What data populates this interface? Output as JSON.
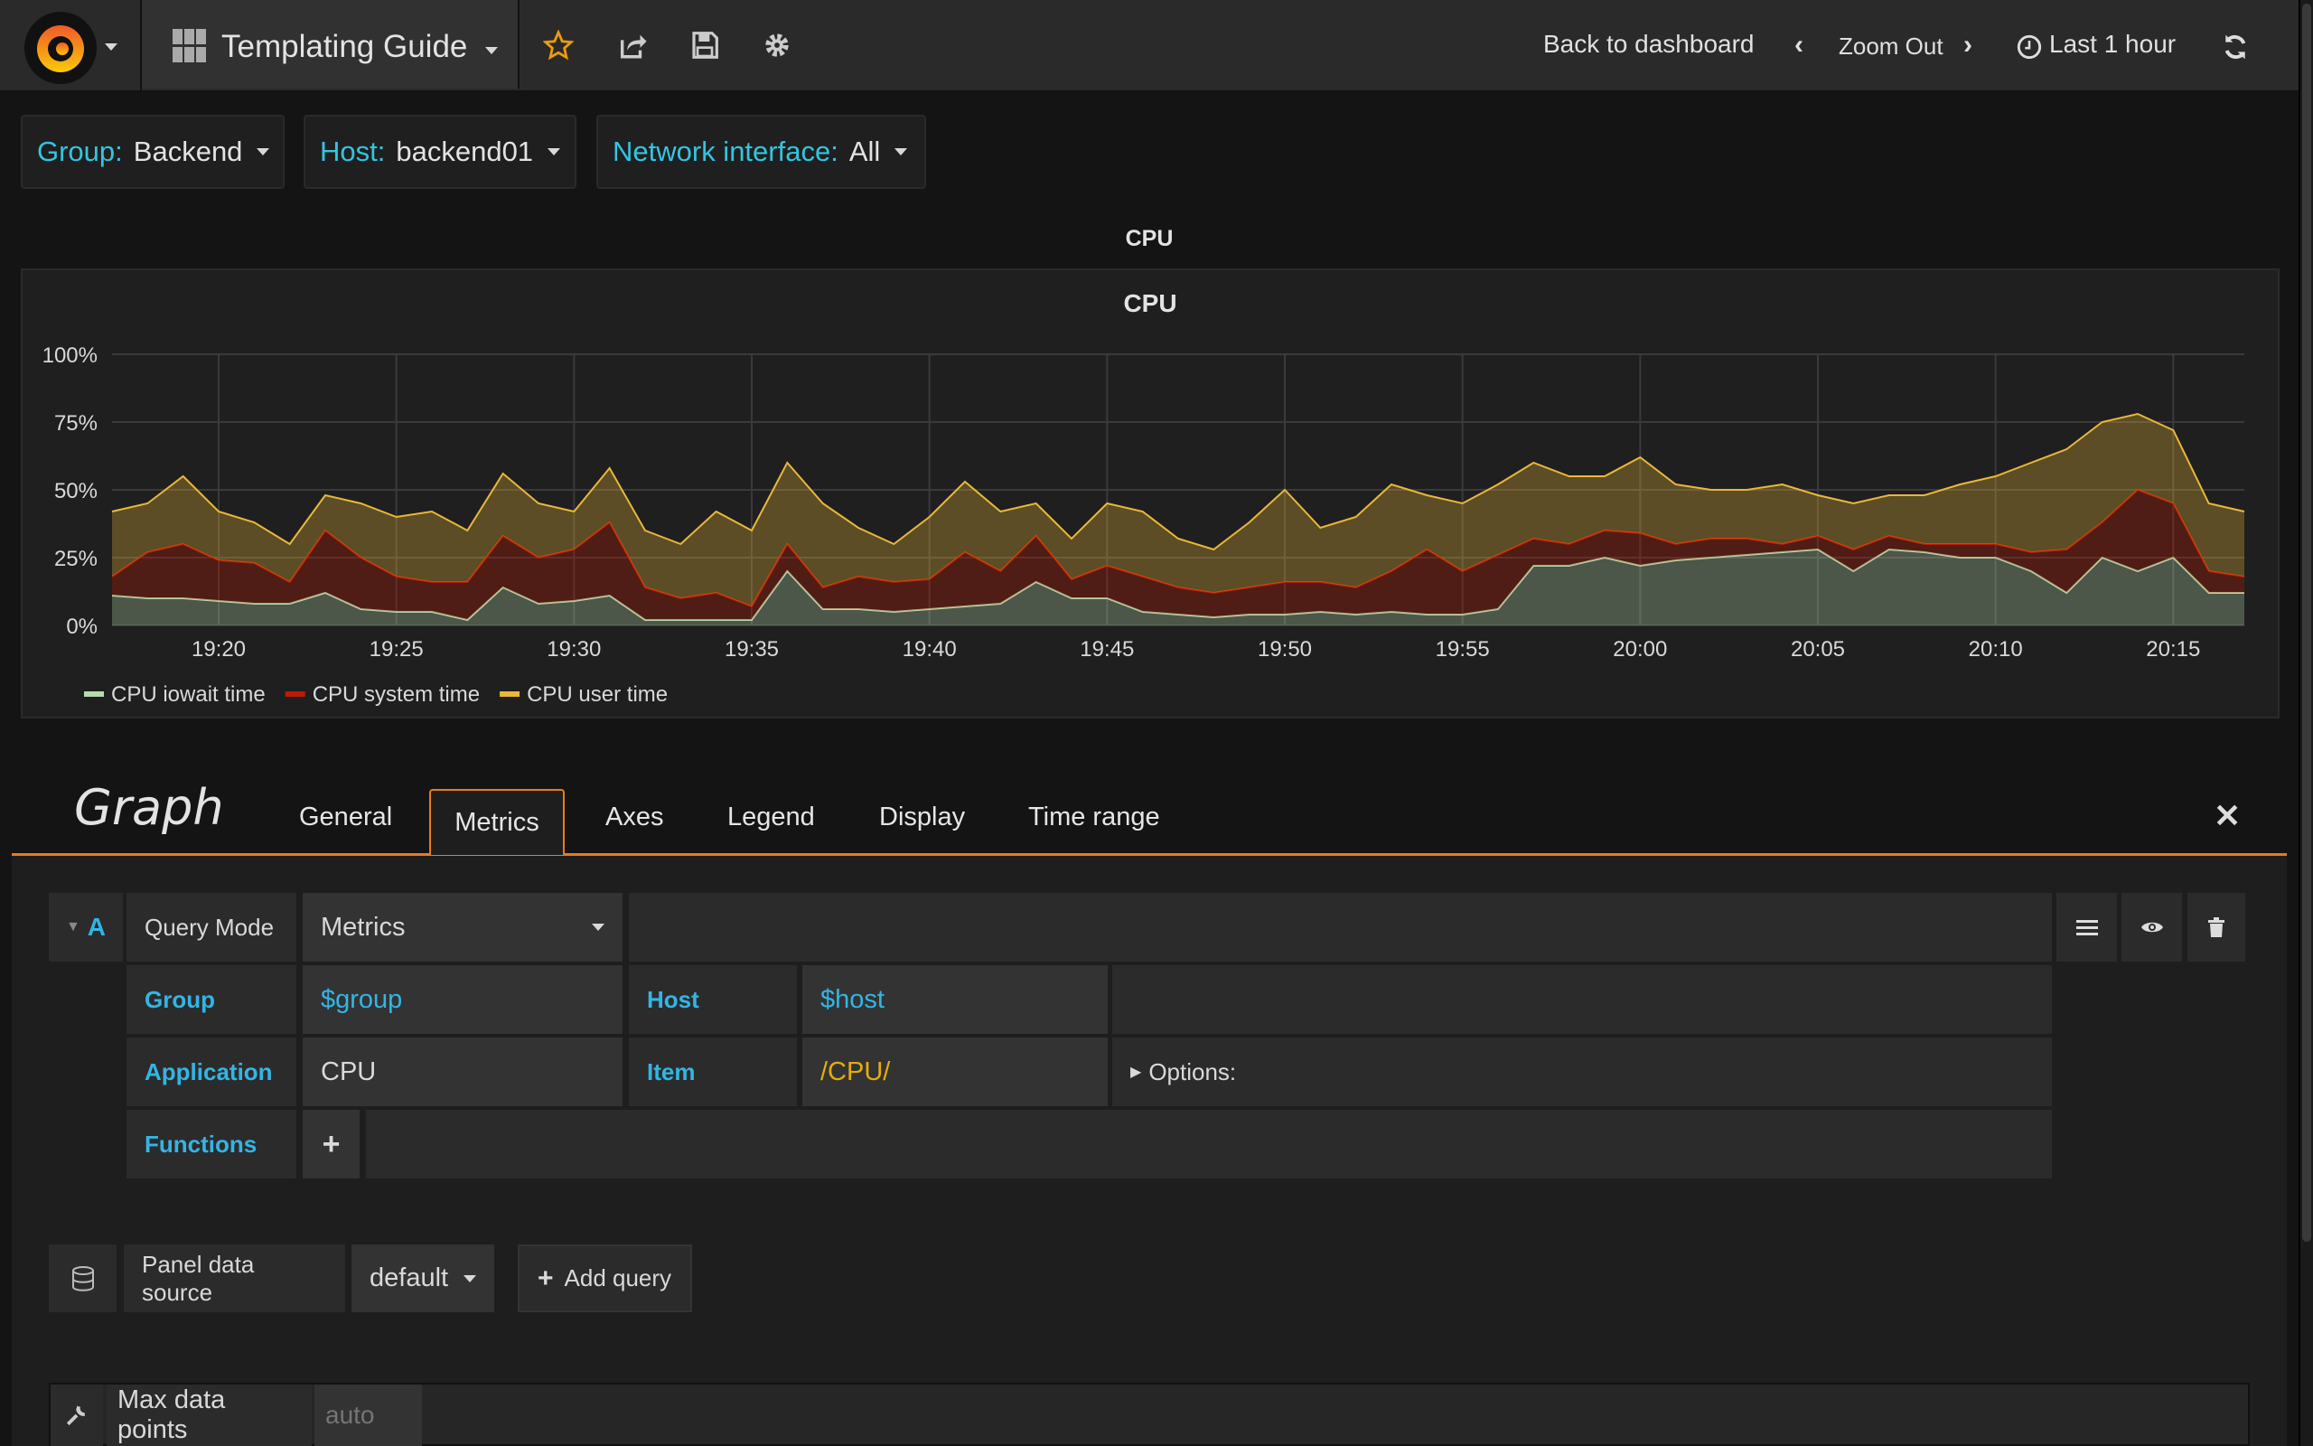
{
  "topbar": {
    "dashboard_title": "Templating Guide",
    "back_to_dashboard": "Back to dashboard",
    "zoom_out": "Zoom Out",
    "time_range": "Last 1 hour",
    "icons": [
      "grafana-logo",
      "dashboard-grid-icon",
      "star-icon",
      "share-icon",
      "save-icon",
      "gear-icon",
      "chevron-left-icon",
      "chevron-right-icon",
      "clock-icon",
      "refresh-icon"
    ]
  },
  "variables": [
    {
      "label": "Group:",
      "value": "Backend"
    },
    {
      "label": "Host:",
      "value": "backend01"
    },
    {
      "label": "Network interface:",
      "value": "All"
    }
  ],
  "row_title": "CPU",
  "panel": {
    "title": "CPU"
  },
  "chart_data": {
    "type": "area",
    "stacked": true,
    "title": "CPU",
    "x": [
      "19:17",
      "19:18",
      "19:19",
      "19:20",
      "19:21",
      "19:22",
      "19:23",
      "19:24",
      "19:25",
      "19:26",
      "19:27",
      "19:28",
      "19:29",
      "19:30",
      "19:31",
      "19:32",
      "19:33",
      "19:34",
      "19:35",
      "19:36",
      "19:37",
      "19:38",
      "19:39",
      "19:40",
      "19:41",
      "19:42",
      "19:43",
      "19:44",
      "19:45",
      "19:46",
      "19:47",
      "19:48",
      "19:49",
      "19:50",
      "19:51",
      "19:52",
      "19:53",
      "19:54",
      "19:55",
      "19:56",
      "19:57",
      "19:58",
      "19:59",
      "20:00",
      "20:01",
      "20:02",
      "20:03",
      "20:04",
      "20:05",
      "20:06",
      "20:07",
      "20:08",
      "20:09",
      "20:10",
      "20:11",
      "20:12",
      "20:13",
      "20:14",
      "20:15",
      "20:16",
      "20:17"
    ],
    "x_ticks": [
      "19:20",
      "19:25",
      "19:30",
      "19:35",
      "19:40",
      "19:45",
      "19:50",
      "19:55",
      "20:00",
      "20:05",
      "20:10",
      "20:15"
    ],
    "y_ticks": [
      "0%",
      "25%",
      "50%",
      "75%",
      "100%"
    ],
    "ylim": [
      0,
      100
    ],
    "grid": true,
    "legend": "bottom-left",
    "series": [
      {
        "name": "CPU iowait time",
        "color": "#b7dbab",
        "values": [
          11,
          10,
          10,
          9,
          8,
          8,
          12,
          6,
          5,
          5,
          2,
          14,
          8,
          9,
          11,
          2,
          2,
          2,
          2,
          20,
          6,
          6,
          5,
          6,
          7,
          8,
          16,
          10,
          10,
          5,
          4,
          3,
          4,
          4,
          5,
          4,
          5,
          4,
          4,
          6,
          22,
          22,
          25,
          22,
          24,
          25,
          26,
          27,
          28,
          20,
          28,
          27,
          25,
          25,
          20,
          12,
          25,
          20,
          25,
          12,
          12
        ]
      },
      {
        "name": "CPU system time",
        "color": "#bf1b00",
        "values": [
          7,
          17,
          20,
          15,
          15,
          8,
          23,
          19,
          13,
          11,
          14,
          19,
          17,
          19,
          27,
          12,
          8,
          10,
          5,
          10,
          8,
          12,
          11,
          11,
          20,
          12,
          17,
          7,
          12,
          13,
          10,
          9,
          10,
          12,
          11,
          10,
          15,
          24,
          16,
          20,
          10,
          8,
          10,
          12,
          6,
          7,
          6,
          3,
          5,
          8,
          5,
          3,
          5,
          5,
          7,
          16,
          13,
          30,
          20,
          8,
          6
        ]
      },
      {
        "name": "CPU user time",
        "color": "#eab839",
        "values": [
          24,
          18,
          25,
          18,
          15,
          14,
          13,
          20,
          22,
          26,
          19,
          23,
          20,
          14,
          20,
          21,
          20,
          30,
          28,
          30,
          31,
          18,
          14,
          23,
          26,
          22,
          12,
          15,
          23,
          24,
          18,
          16,
          24,
          34,
          20,
          26,
          32,
          20,
          25,
          26,
          28,
          25,
          20,
          28,
          22,
          18,
          18,
          22,
          15,
          17,
          15,
          18,
          22,
          25,
          33,
          37,
          37,
          28,
          27,
          25,
          24
        ]
      }
    ]
  },
  "editor": {
    "title": "Graph",
    "tabs": [
      "General",
      "Metrics",
      "Axes",
      "Legend",
      "Display",
      "Time range"
    ],
    "active_tab": "Metrics",
    "query": {
      "ref_id": "A",
      "query_mode_label": "Query Mode",
      "query_mode_value": "Metrics",
      "group_label": "Group",
      "group_value": "$group",
      "host_label": "Host",
      "host_value": "$host",
      "application_label": "Application",
      "application_value": "CPU",
      "item_label": "Item",
      "item_value": "/CPU/",
      "options_label": "Options:",
      "functions_label": "Functions"
    },
    "datasource_label": "Panel data source",
    "datasource_value": "default",
    "add_query": "Add query",
    "max_data_points_label": "Max data points",
    "max_data_points_placeholder": "auto"
  }
}
